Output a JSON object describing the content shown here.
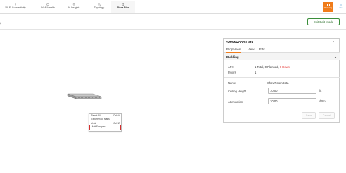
{
  "nav": {
    "tabs": [
      {
        "label": "Wi-Fi Connectivity",
        "icon": "wifi-icon",
        "active": false
      },
      {
        "label": "WAN Health",
        "icon": "wan-icon",
        "active": false
      },
      {
        "label": "AI Insights",
        "icon": "location-pin-icon",
        "active": false
      },
      {
        "label": "Topology",
        "icon": "topology-icon",
        "active": false
      },
      {
        "label": "Floor Plan",
        "icon": "floor-plan-icon",
        "active": true
      }
    ],
    "right_button_label": "Marketing",
    "right_icon_label": "Link"
  },
  "toolbar": {
    "exit_edit_label": "Exit Edit Mode"
  },
  "context_menu": {
    "items": [
      {
        "label": "Select All",
        "shortcut": "Ctrl+A"
      },
      {
        "label": "Export Floor Plans",
        "shortcut": ""
      },
      {
        "label": "Undo",
        "shortcut": "Ctrl+Z"
      },
      {
        "label": "Add Floorplan",
        "shortcut": ""
      }
    ]
  },
  "panel": {
    "title": "ShowRoomData",
    "tabs": [
      "Properties",
      "View",
      "Edit"
    ],
    "section_title": "Building",
    "aps_label": "APs:",
    "aps_value_prefix": "1 Total, 0 Planned, ",
    "aps_value_down": "0 Down",
    "floors_label": "Floors",
    "floors_value": "1",
    "name_label": "Name",
    "name_value": "ShowRoomData",
    "ceiling_label": "Ceiling Height",
    "ceiling_value": "10.00",
    "ceiling_unit": "ft.",
    "attenuation_label": "Attenuation",
    "attenuation_value": "10.00",
    "attenuation_unit": "dBm",
    "save_label": "Save",
    "cancel_label": "Cancel"
  },
  "colors": {
    "accent": "#f07c1a",
    "exit_button": "#3a8e3a",
    "down_status": "#e53935",
    "highlight_box": "#d32f2f"
  }
}
